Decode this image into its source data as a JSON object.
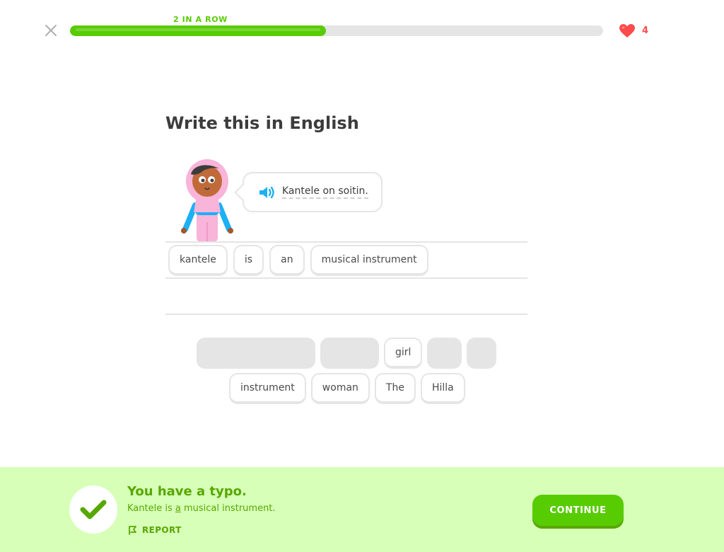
{
  "header": {
    "streak_label": "2 IN A ROW",
    "progress_fraction": 0.48,
    "hearts_count": "4"
  },
  "prompt": {
    "title": "Write this in English",
    "sentence": "Kantele on soitin."
  },
  "answer": {
    "chips": [
      "kantele",
      "is",
      "an",
      "musical instrument"
    ]
  },
  "word_bank": {
    "row1": [
      {
        "label": "",
        "used": true
      },
      {
        "label": "",
        "used": true
      },
      {
        "label": "girl",
        "used": false
      },
      {
        "label": "",
        "used": true
      },
      {
        "label": "",
        "used": true
      }
    ],
    "row2": [
      {
        "label": "instrument",
        "used": false
      },
      {
        "label": "woman",
        "used": false
      },
      {
        "label": "The",
        "used": false
      },
      {
        "label": "Hilla",
        "used": false
      }
    ]
  },
  "feedback": {
    "title": "You have a typo.",
    "correct_before": "Kantele is ",
    "correct_highlight": "a",
    "correct_after": " musical instrument.",
    "report_label": "REPORT",
    "continue_label": "CONTINUE"
  },
  "colors": {
    "green": "#58cc02",
    "dark_green": "#58a700",
    "feedback_bg": "#d7ffb8",
    "heart_red": "#ff4b4b",
    "blue": "#1cb0f6"
  }
}
